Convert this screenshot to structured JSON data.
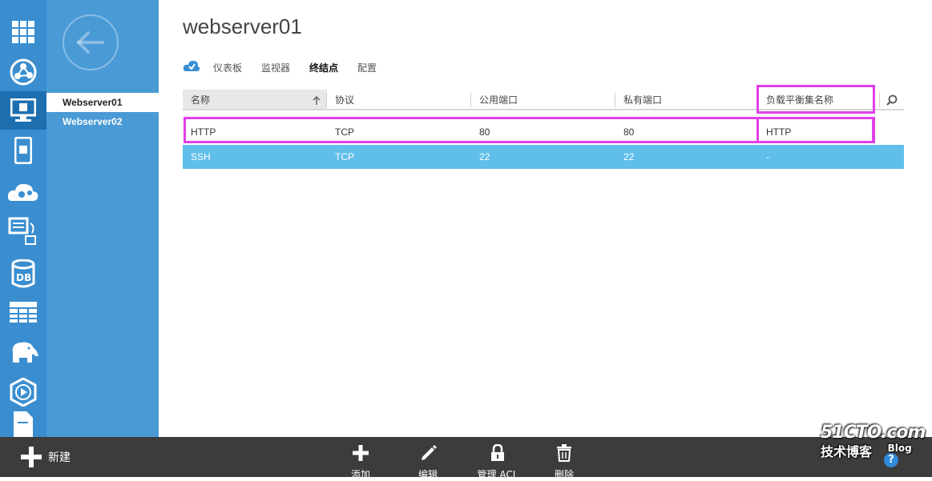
{
  "sidebar": {
    "icons": [
      "grid-icon",
      "globe-icon",
      "virtual-machine-icon",
      "mobile-service-icon",
      "cloud-service-icon",
      "batch-icon",
      "database-icon",
      "table-storage-icon",
      "hdinsight-elephant-icon",
      "media-service-icon",
      "document-icon"
    ],
    "active_index": 2
  },
  "subpanel": {
    "items": [
      {
        "label": "Webserver01",
        "selected": true
      },
      {
        "label": "Webserver02",
        "selected": false
      }
    ]
  },
  "page": {
    "title": "webserver01",
    "tabs": [
      {
        "label": "仪表板",
        "active": false
      },
      {
        "label": "监视器",
        "active": false
      },
      {
        "label": "终结点",
        "active": true
      },
      {
        "label": "配置",
        "active": false
      }
    ]
  },
  "table": {
    "columns": [
      "名称",
      "协议",
      "公用端口",
      "私有端口",
      "负载平衡集名称"
    ],
    "rows": [
      {
        "name": "HTTP",
        "protocol": "TCP",
        "public_port": "80",
        "private_port": "80",
        "lb_set": "HTTP",
        "selected": false
      },
      {
        "name": "SSH",
        "protocol": "TCP",
        "public_port": "22",
        "private_port": "22",
        "lb_set": "-",
        "selected": true
      }
    ],
    "sort_column": "名称",
    "highlight_color": "#e040e8"
  },
  "commandbar": {
    "new_label": "新建",
    "commands": [
      {
        "label": "添加",
        "icon": "plus-icon"
      },
      {
        "label": "编辑",
        "icon": "pencil-icon"
      },
      {
        "label": "管理 ACL",
        "icon": "lock-icon"
      },
      {
        "label": "删除",
        "icon": "trash-icon"
      }
    ]
  },
  "watermark": {
    "line1": "51CTO.com",
    "line2": "技术博客",
    "line3": "Blog"
  },
  "colors": {
    "rail": "#3a8ed0",
    "subpanel": "#4a9ad6",
    "selected_row": "#5fbfea",
    "commandbar": "#3c3c3c"
  }
}
